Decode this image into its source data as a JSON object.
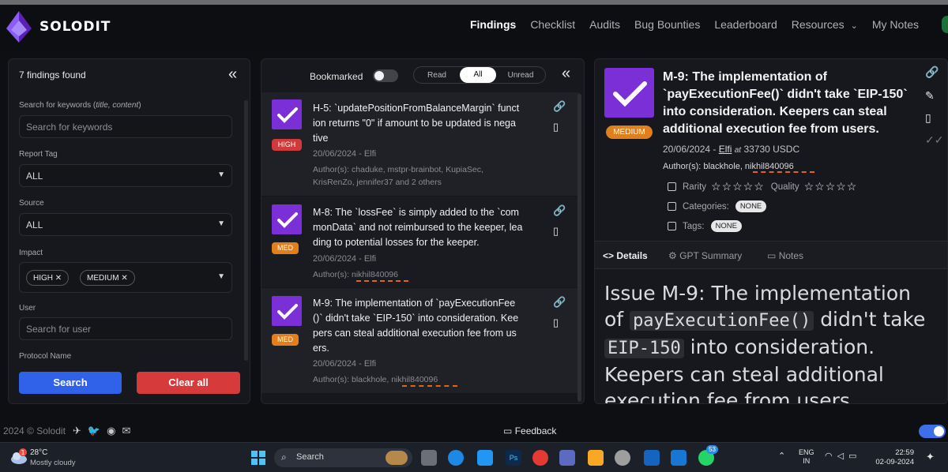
{
  "app": {
    "logo_text": "SOLODIT",
    "brand_color": "#7b2fd6"
  },
  "nav": {
    "items": [
      "Findings",
      "Checklist",
      "Audits",
      "Bug Bounties",
      "Leaderboard",
      "Resources",
      "My Notes"
    ],
    "active": "Findings"
  },
  "filters": {
    "count_label": "7 findings found",
    "keywords_label_prefix": "Search for keywords (",
    "keywords_label_italic": "title, content",
    "keywords_label_suffix": ")",
    "keywords_placeholder": "Search for keywords",
    "report_tag_label": "Report Tag",
    "report_tag_value": "ALL",
    "source_label": "Source",
    "source_value": "ALL",
    "impact_label": "Impact",
    "impact_chips": [
      "HIGH",
      "MEDIUM"
    ],
    "user_label": "User",
    "user_placeholder": "Search for user",
    "protocol_label": "Protocol Name",
    "search_button": "Search",
    "clear_button": "Clear all"
  },
  "list": {
    "bookmarked_label": "Bookmarked",
    "bookmarked_on": false,
    "segments": [
      "Read",
      "All",
      "Unread"
    ],
    "active_segment": "All",
    "cards": [
      {
        "badge": "HIGH",
        "title_lines": [
          "H-5: `updatePositionFromBalanceMargin` funct",
          "ion returns \"0\" if amount to be updated is nega",
          "tive"
        ],
        "meta": "20/06/2024 - Elfi",
        "author_lines": [
          "Author(s): chaduke, mstpr-brainbot, KupiaSec,",
          "KrisRenZo, jennifer37 and 2 others"
        ]
      },
      {
        "badge": "MED",
        "title_lines": [
          "M-8: The `lossFee` is simply added to the `com",
          "monData` and not reimbursed to the keeper, lea",
          "ding to potential losses for the keeper."
        ],
        "meta": "20/06/2024 - Elfi",
        "author_lines": [
          "Author(s): nikhil840096"
        ]
      },
      {
        "badge": "MED",
        "title_lines": [
          "M-9: The implementation of `payExecutionFee",
          "()` didn't take `EIP-150` into consideration. Kee",
          "pers can steal additional execution fee from us",
          "ers."
        ],
        "meta": "20/06/2024 - Elfi",
        "author_lines": [
          "Author(s): blackhole, nikhil840096"
        ]
      }
    ]
  },
  "detail": {
    "badge": "MEDIUM",
    "title": "M-9: The implementation of `payExecutionFee()` didn't take `EIP-150` into consideration. Keepers can steal additional execution fee from users.",
    "date": "20/06/2024 -",
    "protocol": "Elfi",
    "at": "at",
    "amount": "33730 USDC",
    "authors": "Author(s): blackhole, nikhil840096",
    "rarity_label": "Rarity",
    "quality_label": "Quality",
    "rarity_stars": "☆☆☆☆☆",
    "quality_stars": "☆☆☆☆☆",
    "categories_label": "Categories:",
    "categories_value": "NONE",
    "tags_label": "Tags:",
    "tags_value": "NONE",
    "tabs": [
      "Details",
      "GPT Summary",
      "Notes"
    ],
    "active_tab": "Details",
    "body_prefix": "Issue M-9: The implementation of",
    "body_code1": "payExecutionFee()",
    "body_mid": "didn't take",
    "body_code2": "EIP-150",
    "body_suffix_1": "into consideration.",
    "body_suffix_2": "Keepers can steal additional",
    "body_suffix_3": "execution fee from users."
  },
  "footer": {
    "copyright": "2024 © Solodit",
    "feedback": "Feedback"
  },
  "taskbar": {
    "temperature": "28°C",
    "condition": "Mostly cloudy",
    "weather_badge": "1",
    "search_label": "Search",
    "lang_1": "ENG",
    "lang_2": "IN",
    "time": "22:59",
    "date": "02-09-2024",
    "whatsapp_badge": "53"
  }
}
